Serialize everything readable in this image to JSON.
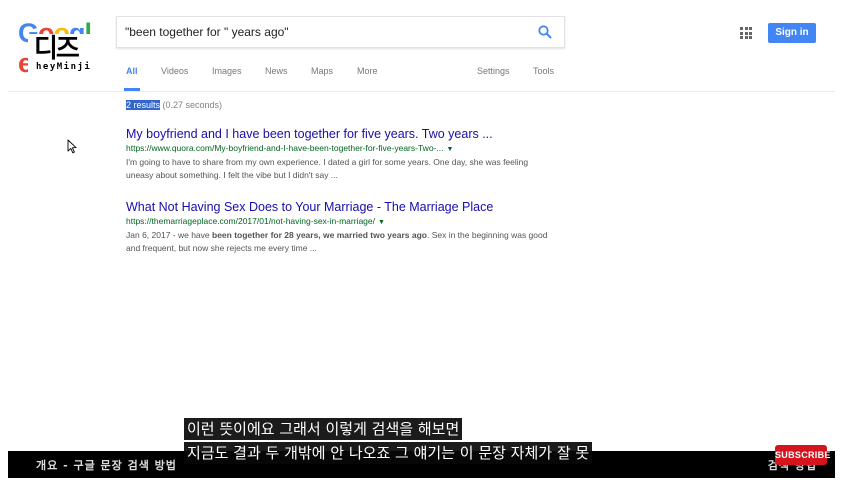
{
  "logo": {
    "letters": [
      "G",
      "o",
      "o",
      "g",
      "l",
      "e"
    ],
    "colors": [
      "#4285f4",
      "#ea4335",
      "#fbbc05",
      "#4285f4",
      "#34a853",
      "#ea4335"
    ]
  },
  "watermark": {
    "glyph": "디즈",
    "text": "heyMinji"
  },
  "search": {
    "value": "\"been together for \" years ago\""
  },
  "header": {
    "signin_label": "Sign in"
  },
  "tabs": {
    "items": [
      "All",
      "Videos",
      "Images",
      "News",
      "Maps",
      "More"
    ],
    "right": [
      "Settings",
      "Tools"
    ]
  },
  "stats": {
    "selected": "2 results",
    "rest": " (0.27 seconds)"
  },
  "results": [
    {
      "title": "My boyfriend and I have been together for five years. Two years ...",
      "url": "https://www.quora.com/My-boyfriend-and-I-have-been-together-for-five-years-Two-...",
      "snippet": "I'm going to have to share from my own experience. I dated a girl for some years. One day, she was feeling uneasy about something. I felt the vibe but I didn't say ..."
    },
    {
      "title": "What Not Having Sex Does to Your Marriage - The Marriage Place",
      "url": "https://themarriageplace.com/2017/01/not-having-sex-in-marriage/",
      "snippet_pre": "Jan 6, 2017 - we have ",
      "snippet_bold": "been together for 28 years, we married two years ago",
      "snippet_post": ". Sex in the beginning was good and frequent, but now she rejects me every time ..."
    }
  ],
  "captions": {
    "line1": "이런 뜻이에요 그래서 이렇게 검색을 해보면",
    "line2": "지금도 결과 두 개밖에 안 나오죠 그 얘기는 이 문장 자체가 잘 못"
  },
  "bottom_bar": {
    "left": "개요  -  구글 문장 검색 방법",
    "right": "검색 방법"
  },
  "subscribe": {
    "label": "SUBSCRIBE"
  },
  "colors": {
    "accent": "#4285f4",
    "link": "#1a0dab",
    "url": "#006621",
    "subscribe": "#d6141e"
  }
}
